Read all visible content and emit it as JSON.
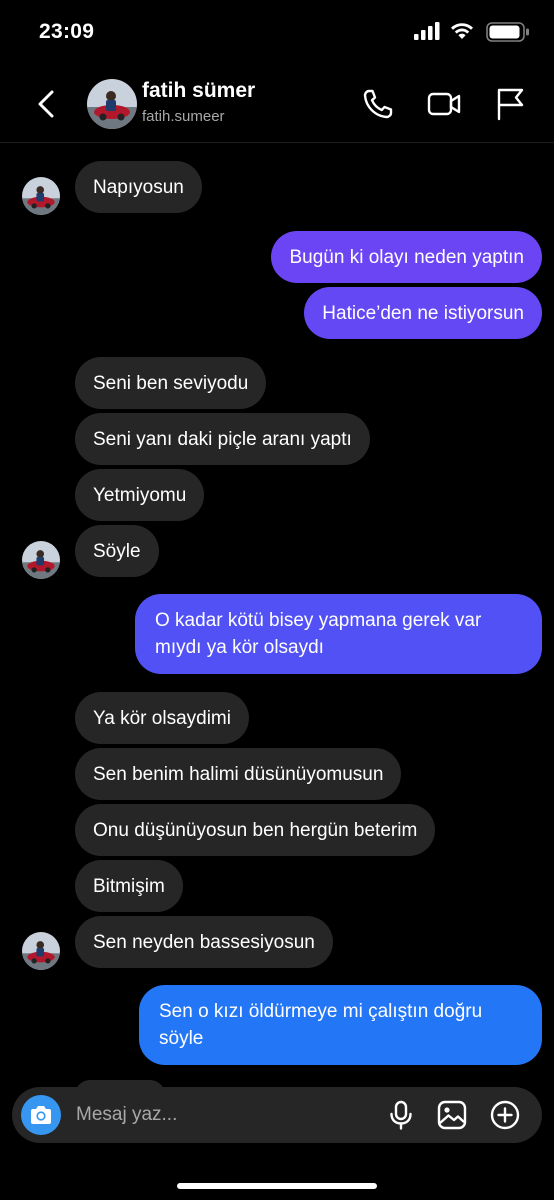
{
  "status_bar": {
    "time": "23:09",
    "battery_icon": "battery-icon",
    "wifi_icon": "wifi-icon",
    "signal_icon": "signal-icon"
  },
  "header": {
    "name": "fatih sümer",
    "username": "fatih.sumeer",
    "icons": [
      "back-chevron-icon",
      "phone-icon",
      "video-camera-icon",
      "flag-icon"
    ]
  },
  "messages": [
    {
      "from": "them",
      "text": "Napıyosun"
    },
    {
      "from": "me",
      "text": "Bugün ki olayı neden yaptın"
    },
    {
      "from": "me",
      "text": "Hatice’den ne istiyorsun"
    },
    {
      "from": "them",
      "text": "Seni ben seviyodu"
    },
    {
      "from": "them",
      "text": "Seni yanı daki piçle aranı yaptı"
    },
    {
      "from": "them",
      "text": "Yetmiyomu"
    },
    {
      "from": "them",
      "text": "Söyle"
    },
    {
      "from": "me",
      "text": "O kadar kötü bisey yapmana gerek var mıydı ya kör olsaydı"
    },
    {
      "from": "them",
      "text": "Ya kör olsaydimi"
    },
    {
      "from": "them",
      "text": "Sen benim halimi düsünüyomusun"
    },
    {
      "from": "them",
      "text": "Onu düşünüyosun ben hergün beterim"
    },
    {
      "from": "them",
      "text": "Bitmişim"
    },
    {
      "from": "them",
      "text": "Sen neyden bassesiyosun"
    },
    {
      "from": "me",
      "text": "Sen o kızı öldürmeye mi çalıştın doğru söyle"
    }
  ],
  "composer": {
    "placeholder": "Mesaj yaz...",
    "icons": [
      "camera-icon",
      "microphone-icon",
      "image-icon",
      "plus-circle-icon"
    ]
  },
  "colors": {
    "background": "#000000",
    "received_bubble": "#262626",
    "sent_gradient": [
      "#7b3ff2",
      "#1f74f6"
    ],
    "camera_button": "#3797f0"
  }
}
